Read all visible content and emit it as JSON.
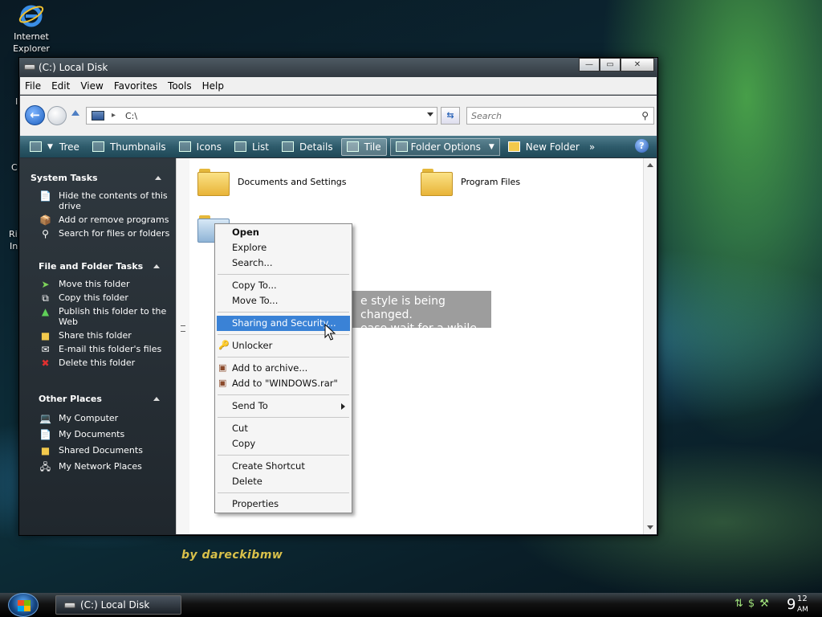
{
  "desktop": {
    "icons": [
      {
        "name": "Internet Explorer",
        "line1": "Internet",
        "line2": "Explorer"
      }
    ],
    "edge_glyphs": [
      "I",
      "C",
      "Ri",
      "In"
    ]
  },
  "window": {
    "title": "(C:) Local Disk",
    "buttons": {
      "minimize": "—",
      "maximize": "▭",
      "close": "✕"
    }
  },
  "menu": [
    "File",
    "Edit",
    "View",
    "Favorites",
    "Tools",
    "Help"
  ],
  "address": {
    "path": "C:\\",
    "separator": "▸"
  },
  "search": {
    "placeholder": "Search"
  },
  "toolbar": {
    "items": [
      "Tree",
      "Thumbnails",
      "Icons",
      "List",
      "Details",
      "Tile"
    ],
    "active": "Tile",
    "folder_options": "Folder Options",
    "new_folder": "New Folder",
    "more": "»",
    "help": "?"
  },
  "left_pane": {
    "sections": [
      {
        "title": "System Tasks",
        "items": [
          {
            "label": "Hide the contents of this drive",
            "icon": "hide-contents-icon"
          },
          {
            "label": "Add or remove programs",
            "icon": "programs-icon"
          },
          {
            "label": "Search for files or folders",
            "icon": "search-icon"
          }
        ]
      },
      {
        "title": "File and Folder Tasks",
        "items": [
          {
            "label": "Move this folder",
            "icon": "move-icon"
          },
          {
            "label": "Copy this folder",
            "icon": "copy-icon"
          },
          {
            "label": "Publish this folder to the Web",
            "icon": "web-icon"
          },
          {
            "label": "Share this folder",
            "icon": "share-icon"
          },
          {
            "label": "E-mail this folder's files",
            "icon": "email-icon"
          },
          {
            "label": "Delete this folder",
            "icon": "delete-icon"
          }
        ]
      },
      {
        "title": "Other Places",
        "items": [
          {
            "label": "My Computer",
            "icon": "computer-icon"
          },
          {
            "label": "My Documents",
            "icon": "documents-icon"
          },
          {
            "label": "Shared Documents",
            "icon": "shared-folder-icon"
          },
          {
            "label": "My Network Places",
            "icon": "network-icon"
          }
        ]
      }
    ]
  },
  "content": {
    "folders": [
      "Documents and Settings",
      "Program Files"
    ]
  },
  "notice": {
    "line1": "e style is being changed.",
    "line2": "ease wait for a while."
  },
  "context_menu": {
    "groups": [
      [
        {
          "label": "Open",
          "bold": true
        },
        {
          "label": "Explore"
        },
        {
          "label": "Search..."
        }
      ],
      [
        {
          "label": "Copy To..."
        },
        {
          "label": "Move To..."
        }
      ],
      [
        {
          "label": "Sharing and Security...",
          "highlighted": true
        }
      ],
      [
        {
          "label": "Unlocker",
          "icon": "unlocker-icon"
        }
      ],
      [
        {
          "label": "Add to archive...",
          "icon": "winrar-icon"
        },
        {
          "label": "Add to \"WINDOWS.rar\"",
          "icon": "winrar-icon"
        }
      ],
      [
        {
          "label": "Send To",
          "submenu": true
        }
      ],
      [
        {
          "label": "Cut"
        },
        {
          "label": "Copy"
        }
      ],
      [
        {
          "label": "Create Shortcut"
        },
        {
          "label": "Delete"
        }
      ],
      [
        {
          "label": "Properties"
        }
      ]
    ]
  },
  "signature": "by dareckibmw",
  "taskbar": {
    "task_label": "(C:) Local Disk",
    "clock_hour": "9",
    "clock_minute": "12",
    "clock_ampm": "AM"
  },
  "colors": {
    "highlight": "#3a82d6",
    "toolbar": "#2e5b6b",
    "folder": "#e8b438"
  }
}
